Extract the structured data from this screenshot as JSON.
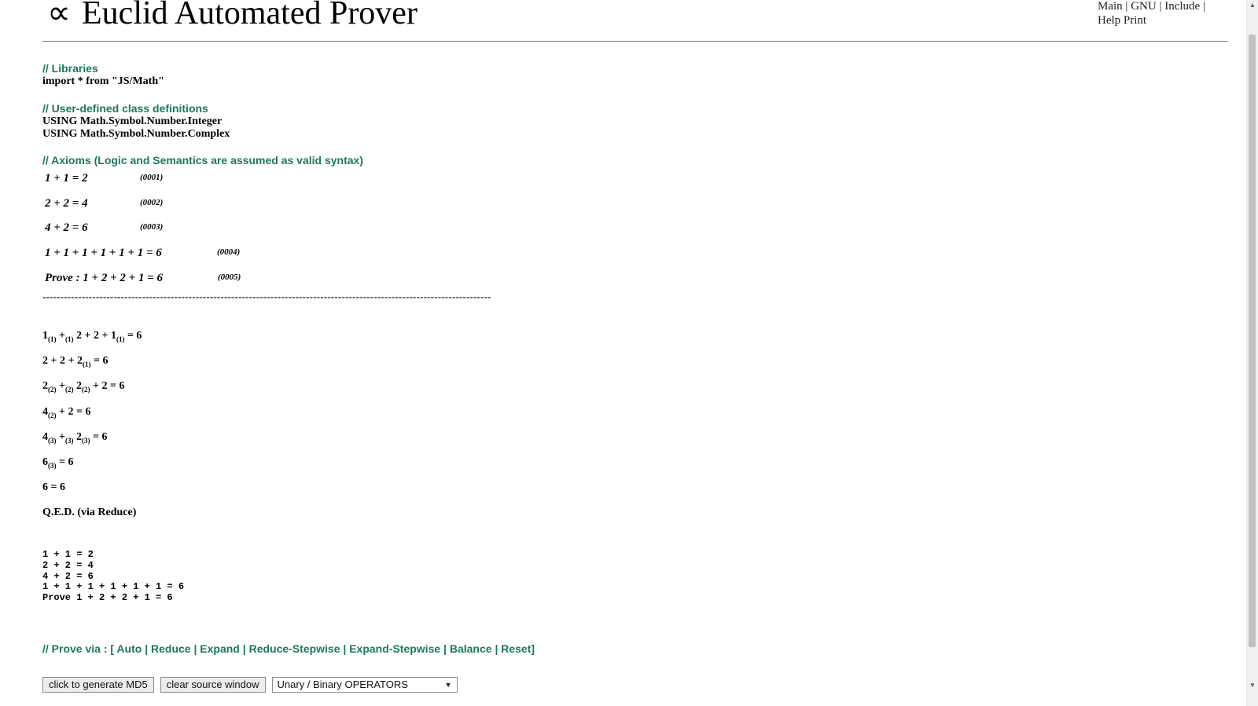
{
  "header": {
    "symbol": "∝",
    "title": "Euclid Automated Prover",
    "nav": {
      "main": "Main",
      "gnu": "GNU",
      "include": "Include",
      "help": "Help",
      "print": "Print",
      "sep": "|"
    }
  },
  "libraries": {
    "comment": "// Libraries",
    "import": "import * from \"JS/Math\""
  },
  "classes": {
    "comment": "// User-defined class definitions",
    "lines": [
      "USING Math.Symbol.Number.Integer",
      "USING Math.Symbol.Number.Complex"
    ]
  },
  "axioms": {
    "comment": "// Axioms (Logic and Semantics are assumed as valid syntax)",
    "items": [
      {
        "expr": "1 + 1 = 2",
        "num": "(0001)"
      },
      {
        "expr": "2 + 2 = 4",
        "num": "(0002)"
      },
      {
        "expr": "4 + 2 = 6",
        "num": "(0003)"
      },
      {
        "expr": "1 + 1 + 1 + 1 + 1 + 1 = 6",
        "num": "(0004)"
      },
      {
        "expr": "Prove : 1 + 2 + 2 + 1 = 6",
        "num": "(0005)"
      }
    ],
    "rule": "------------------------------------------------------------------------------------------------------------------------------"
  },
  "proof": {
    "steps": [
      [
        [
          "1",
          "(1)"
        ],
        [
          " +",
          "(1)"
        ],
        [
          " 2 + 2 + 1",
          "(1)"
        ],
        [
          " = 6",
          ""
        ]
      ],
      [
        [
          "2 + 2 + 2",
          "(1)"
        ],
        [
          " = 6",
          ""
        ]
      ],
      [
        [
          "2",
          "(2)"
        ],
        [
          " +",
          "(2)"
        ],
        [
          " 2",
          "(2)"
        ],
        [
          " + 2 = 6",
          ""
        ]
      ],
      [
        [
          "4",
          "(2)"
        ],
        [
          " + 2 = 6",
          ""
        ]
      ],
      [
        [
          "4",
          "(3)"
        ],
        [
          " +",
          "(3)"
        ],
        [
          " 2",
          "(3)"
        ],
        [
          " = 6",
          ""
        ]
      ],
      [
        [
          "6",
          "(3)"
        ],
        [
          " = 6",
          ""
        ]
      ],
      [
        [
          "6 = 6",
          ""
        ]
      ]
    ],
    "qed": "Q.E.D. (via Reduce)"
  },
  "source": {
    "lines": [
      "1 + 1 = 2",
      "2 + 2 = 4",
      "4 + 2 = 6",
      "1 + 1 + 1 + 1 + 1 + 1 = 6",
      "Prove 1 + 2 + 2 + 1 = 6"
    ]
  },
  "prove_via": {
    "prefix": "// Prove via : [",
    "links": [
      "Auto",
      "Reduce",
      "Expand",
      "Reduce-Stepwise",
      "Expand-Stepwise",
      "Balance",
      "Reset"
    ],
    "sep": "|",
    "suffix": "]"
  },
  "controls": {
    "md5_button": "click to generate MD5",
    "clear_button": "clear source window",
    "operators_select": "Unary / Binary OPERATORS"
  },
  "colors": {
    "comment_green": "#1a7a5a",
    "rule_gray": "#7a7a7a"
  }
}
